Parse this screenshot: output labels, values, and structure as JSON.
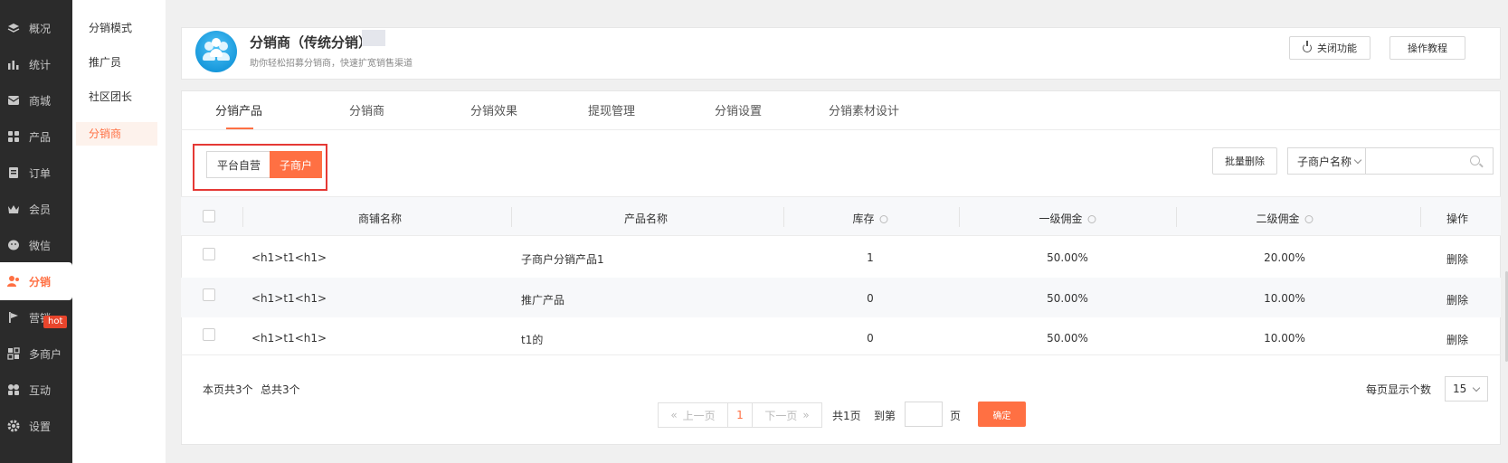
{
  "nav": {
    "items": [
      {
        "label": "概况",
        "icon": "layers-icon"
      },
      {
        "label": "统计",
        "icon": "chart-icon"
      },
      {
        "label": "商城",
        "icon": "mail-icon"
      },
      {
        "label": "产品",
        "icon": "grid-icon"
      },
      {
        "label": "订单",
        "icon": "order-icon"
      },
      {
        "label": "会员",
        "icon": "crown-icon"
      },
      {
        "label": "微信",
        "icon": "wechat-icon"
      },
      {
        "label": "分销",
        "icon": "distribution-icon"
      },
      {
        "label": "营销",
        "icon": "flag-icon"
      },
      {
        "label": "多商户",
        "icon": "merchant-icon"
      },
      {
        "label": "互动",
        "icon": "interaction-icon"
      },
      {
        "label": "设置",
        "icon": "gear-icon"
      }
    ],
    "active_index": 7,
    "hot_badge": "hot",
    "accent_color": "#ff7043"
  },
  "submenu": {
    "items": [
      "分销模式",
      "推广员",
      "社区团长",
      "分销商"
    ],
    "active_index": 3
  },
  "header": {
    "title": "分销商（传统分销）",
    "subtitle": "助你轻松招募分销商，快速扩宽销售渠道",
    "close_feature": "关闭功能",
    "tutorial": "操作教程"
  },
  "tabs": {
    "items": [
      "分销产品",
      "分销商",
      "分销效果",
      "提现管理",
      "分销设置",
      "分销素材设计"
    ],
    "active_index": 0
  },
  "segment": {
    "platform": "平台自营",
    "sub_merchant": "子商户",
    "selected": "子商户"
  },
  "toolbar": {
    "batch_delete": "批量删除",
    "filter_select": "子商户名称",
    "search_placeholder": ""
  },
  "table": {
    "headers": {
      "shop": "商铺名称",
      "product": "产品名称",
      "stock": "库存",
      "commission1": "一级佣金",
      "commission2": "二级佣金",
      "action": "操作"
    },
    "rows": [
      {
        "shop": "<h1>t1<h1>",
        "product": "子商户分销产品1",
        "stock": "1",
        "commission1": "50.00%",
        "commission2": "20.00%",
        "action": "删除"
      },
      {
        "shop": "<h1>t1<h1>",
        "product": "推广产品",
        "stock": "0",
        "commission1": "50.00%",
        "commission2": "10.00%",
        "action": "删除"
      },
      {
        "shop": "<h1>t1<h1>",
        "product": "t1的",
        "stock": "0",
        "commission1": "50.00%",
        "commission2": "10.00%",
        "action": "删除"
      }
    ]
  },
  "footer": {
    "page_count": "本页共3个",
    "total_count": "总共3个",
    "prev": "上一页",
    "current_page": "1",
    "next": "下一页",
    "total_pages": "共1页",
    "goto_prefix": "到第",
    "goto_suffix": "页",
    "confirm": "确定",
    "per_page_label": "每页显示个数",
    "per_page": "15"
  }
}
